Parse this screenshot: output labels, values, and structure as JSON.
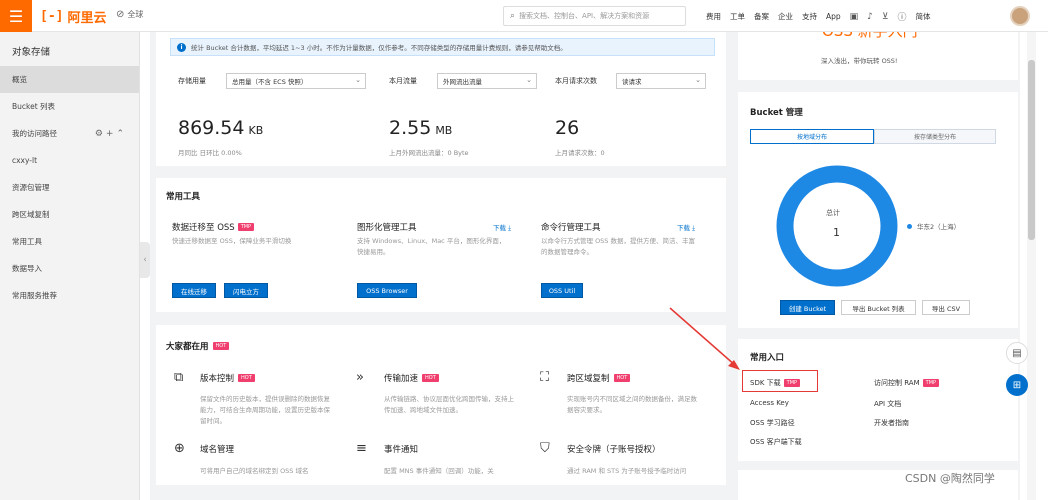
{
  "topbar": {
    "menu_icon": "hamburger-icon",
    "logo_mark": "[-]",
    "logo_text": "阿里云",
    "region": "全球",
    "search_placeholder": "搜索文档、控制台、API、解决方案和资源",
    "nav": [
      "费用",
      "工单",
      "备案",
      "企业",
      "支持",
      "App"
    ],
    "lang": "简体"
  },
  "sidebar": {
    "title": "对象存储",
    "items": [
      {
        "label": "概览",
        "active": true
      },
      {
        "label": "Bucket 列表"
      },
      {
        "label": "我的访问路径"
      },
      {
        "label": "cxxy-lt"
      },
      {
        "label": "资源包管理"
      },
      {
        "label": "跨区域复制"
      },
      {
        "label": "常用工具"
      },
      {
        "label": "数据导入"
      },
      {
        "label": "常用服务推荐"
      }
    ]
  },
  "notice": "统计 Bucket 合计数据，平均延迟 1~3 小时。不作为计量数据，仅作参考。不同存储类型的存储用量计费规则，请参见帮助文档。",
  "stats": {
    "storage": {
      "label": "存储用量",
      "select": "总用量（不含 ECS 快照）",
      "value": "869.54",
      "unit": "KB",
      "sub": "月同比  日环比 0.00%"
    },
    "traffic": {
      "label": "本月流量",
      "select": "外网流出流量",
      "value": "2.55",
      "unit": "MB",
      "sub": "上月外网流出流量：0 Byte"
    },
    "requests": {
      "label": "本月请求次数",
      "select": "读请求",
      "value": "26",
      "unit": "",
      "sub": "上月请求次数：0"
    }
  },
  "tools": {
    "title": "常用工具",
    "items": [
      {
        "name": "数据迁移至 OSS",
        "badge": "TMP",
        "desc": "快速迁移数据至 OSS，保障业务平滑切换",
        "buttons": [
          "在线迁移",
          "闪电立方"
        ],
        "link": ""
      },
      {
        "name": "图形化管理工具",
        "badge": "",
        "desc": "支持 Windows、Linux、Mac 平台，图形化界面，快捷易用。",
        "buttons": [
          "OSS Browser"
        ],
        "link": "下载 ⤓"
      },
      {
        "name": "命令行管理工具",
        "badge": "",
        "desc": "以命令行方式管理 OSS 数据，提供方便、简洁、丰富的数据管理命令。",
        "buttons": [
          "OSS Util"
        ],
        "link": "下载 ⤓"
      }
    ]
  },
  "popular": {
    "title": "大家都在用",
    "badge": "HOT",
    "items": [
      {
        "icon": "copy-icon",
        "glyph": "⧉",
        "name": "版本控制",
        "badge": "HOT",
        "desc": "保留文件的历史版本，提供误删除的数据恢复能力，可结合生命周期功能，设置历史版本保留时间。"
      },
      {
        "icon": "accelerate-icon",
        "glyph": "»",
        "name": "传输加速",
        "badge": "HOT",
        "desc": "从传输链路、协议层面优化跨国传输，支持上传加速、跨地域文件加速。"
      },
      {
        "icon": "replication-icon",
        "glyph": "⛶",
        "name": "跨区域复制",
        "badge": "HOT",
        "desc": "实现账号内不同区域之间的数据备份，满足数据容灾要求。"
      },
      {
        "icon": "globe-icon",
        "glyph": "⊕",
        "name": "域名管理",
        "badge": "",
        "desc": "可将用户自己的域名绑定到 OSS 域名"
      },
      {
        "icon": "event-icon",
        "glyph": "≡",
        "name": "事件通知",
        "badge": "",
        "desc": "配置 MNS 事件通知（回调）功能，关"
      },
      {
        "icon": "shield-icon",
        "glyph": "⛉",
        "name": "安全令牌（子账号授权）",
        "badge": "",
        "desc": "通过 RAM 和 STS 为子账号授予临时访问"
      }
    ]
  },
  "newbie": {
    "title": "OSS 新手入门",
    "sub": "深入浅出，带你玩转 OSS!"
  },
  "bucket_mgmt": {
    "title": "Bucket 管理",
    "tabs": [
      "按地域分布",
      "按存储类型分布"
    ],
    "center_label": "总计",
    "center_value": "1",
    "legend": "华东2（上海）",
    "ring_color": "#1e88e5",
    "buttons": [
      "创建 Bucket",
      "导出 Bucket 列表",
      "导出 CSV"
    ]
  },
  "entries": {
    "title": "常用入口",
    "left": [
      {
        "label": "SDK 下载",
        "badge": "TMP"
      },
      {
        "label": "Access Key"
      },
      {
        "label": "OSS 学习路径"
      },
      {
        "label": "OSS 客户端下载"
      }
    ],
    "right": [
      {
        "label": "访问控制 RAM",
        "badge": "TMP"
      },
      {
        "label": "API 文档"
      },
      {
        "label": "开发者指南"
      }
    ]
  },
  "watermark": "CSDN @陶然同学"
}
